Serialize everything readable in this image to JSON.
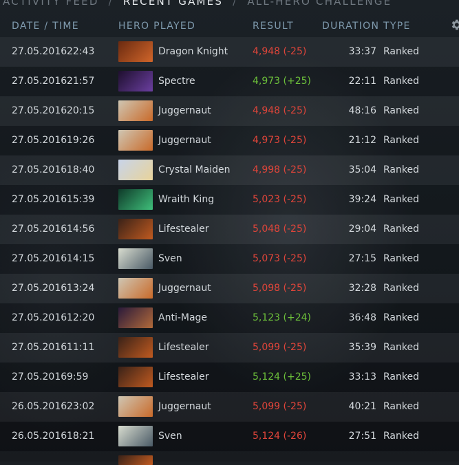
{
  "nav": {
    "tabs": [
      "Activity Feed",
      "Recent Games",
      "All-Hero Challenge"
    ],
    "active_index": 1,
    "separator": "/"
  },
  "table": {
    "headers": {
      "date_time": "Date / Time",
      "hero": "Hero Played",
      "result": "Result",
      "duration": "Duration",
      "type": "Type"
    },
    "settings_icon": "gear-icon",
    "rows": [
      {
        "date": "27.05.2016",
        "time": "22:43",
        "hero": "Dragon Knight",
        "result": "4,948 (-25)",
        "outcome": "loss",
        "duration": "33:37",
        "type": "Ranked"
      },
      {
        "date": "27.05.2016",
        "time": "21:57",
        "hero": "Spectre",
        "result": "4,973 (+25)",
        "outcome": "win",
        "duration": "22:11",
        "type": "Ranked"
      },
      {
        "date": "27.05.2016",
        "time": "20:15",
        "hero": "Juggernaut",
        "result": "4,948 (-25)",
        "outcome": "loss",
        "duration": "48:16",
        "type": "Ranked"
      },
      {
        "date": "27.05.2016",
        "time": "19:26",
        "hero": "Juggernaut",
        "result": "4,973 (-25)",
        "outcome": "loss",
        "duration": "21:12",
        "type": "Ranked"
      },
      {
        "date": "27.05.2016",
        "time": "18:40",
        "hero": "Crystal Maiden",
        "result": "4,998 (-25)",
        "outcome": "loss",
        "duration": "35:04",
        "type": "Ranked"
      },
      {
        "date": "27.05.2016",
        "time": "15:39",
        "hero": "Wraith King",
        "result": "5,023 (-25)",
        "outcome": "loss",
        "duration": "39:24",
        "type": "Ranked"
      },
      {
        "date": "27.05.2016",
        "time": "14:56",
        "hero": "Lifestealer",
        "result": "5,048 (-25)",
        "outcome": "loss",
        "duration": "29:04",
        "type": "Ranked"
      },
      {
        "date": "27.05.2016",
        "time": "14:15",
        "hero": "Sven",
        "result": "5,073 (-25)",
        "outcome": "loss",
        "duration": "27:15",
        "type": "Ranked"
      },
      {
        "date": "27.05.2016",
        "time": "13:24",
        "hero": "Juggernaut",
        "result": "5,098 (-25)",
        "outcome": "loss",
        "duration": "32:28",
        "type": "Ranked"
      },
      {
        "date": "27.05.2016",
        "time": "12:20",
        "hero": "Anti-Mage",
        "result": "5,123 (+24)",
        "outcome": "win",
        "duration": "36:48",
        "type": "Ranked"
      },
      {
        "date": "27.05.2016",
        "time": "11:11",
        "hero": "Lifestealer",
        "result": "5,099 (-25)",
        "outcome": "loss",
        "duration": "35:39",
        "type": "Ranked"
      },
      {
        "date": "27.05.2016",
        "time": "9:59",
        "hero": "Lifestealer",
        "result": "5,124 (+25)",
        "outcome": "win",
        "duration": "33:13",
        "type": "Ranked"
      },
      {
        "date": "26.05.2016",
        "time": "23:02",
        "hero": "Juggernaut",
        "result": "5,099 (-25)",
        "outcome": "loss",
        "duration": "40:21",
        "type": "Ranked"
      },
      {
        "date": "26.05.2016",
        "time": "18:21",
        "hero": "Sven",
        "result": "5,124 (-26)",
        "outcome": "loss",
        "duration": "27:51",
        "type": "Ranked"
      }
    ]
  },
  "hero_colors": {
    "Dragon Knight": [
      "#6a2a10",
      "#d0652a"
    ],
    "Spectre": [
      "#1e0f2e",
      "#6b3fa0"
    ],
    "Juggernaut": [
      "#cfc6b3",
      "#c96a2a"
    ],
    "Crystal Maiden": [
      "#c8d4ea",
      "#e8d39a"
    ],
    "Wraith King": [
      "#0f3a2a",
      "#3fbf7a"
    ],
    "Lifestealer": [
      "#3a2218",
      "#c05a20"
    ],
    "Sven": [
      "#d8dccf",
      "#4a5a66"
    ],
    "Anti-Mage": [
      "#2a1a3a",
      "#b26a3a"
    ]
  }
}
